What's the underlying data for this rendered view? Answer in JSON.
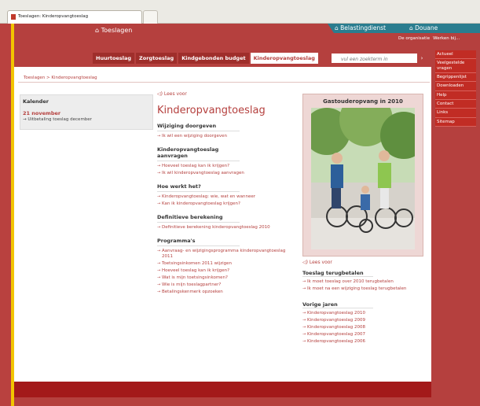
{
  "browser": {
    "tab_title": "Toeslagen: Kinderopvangtoeslag"
  },
  "header": {
    "home_label": "⌂ Toeslagen",
    "belastingdienst": "⌂ Belastingdienst",
    "douane": "⌂ Douane",
    "org_links": [
      "De organisatie",
      "Werken bij..."
    ]
  },
  "nav": {
    "tabs": [
      "Huurtoeslag",
      "Zorgtoeslag",
      "Kindgebonden budget",
      "Kinderopvangtoeslag"
    ],
    "active": "Kinderopvangtoeslag"
  },
  "search": {
    "placeholder": "vul een zoekterm in",
    "go": "›"
  },
  "right_menu": [
    "Actueel",
    "Veelgestelde vragen",
    "Begrippenlijst",
    "Downloaden",
    "Help",
    "Contact",
    "Links",
    "Sitemap"
  ],
  "breadcrumb": "Toeslagen > Kinderopvangtoeslag",
  "calendar": {
    "title": "Kalender",
    "date": "21 november",
    "event": "→ Uitbetaling toeslag december"
  },
  "main": {
    "lees_voor": "◁) Lees voor",
    "title": "Kinderopvangtoeslag",
    "sections": [
      {
        "heading": "Wijziging doorgeven",
        "links": [
          "Ik wil een wijziging doorgeven"
        ]
      },
      {
        "heading": "Kinderopvangtoeslag aanvragen",
        "links": [
          "Hoeveel toeslag kan ik krijgen?",
          "Ik wil kinderopvangtoeslag aanvragen"
        ]
      },
      {
        "heading": "Hoe werkt het?",
        "links": [
          "Kinderopvangtoeslag: wie, wat en wanneer",
          "Kan ik kinderopvangtoeslag krijgen?"
        ]
      },
      {
        "heading": "Definitieve berekening",
        "links": [
          "Definitieve berekening kinderopvangtoeslag 2010"
        ]
      },
      {
        "heading": "Programma's",
        "links": [
          "Aanvraag- en wijzigingsprogramma kinderopvangtoeslag 2011",
          "Toetsingsinkomen 2011 wijzigen",
          "Hoeveel toeslag kan ik krijgen?",
          "Wat is mijn toetsingsinkomen?",
          "Wie is mijn toeslagpartner?",
          "Betalingskenmerk opzoeken"
        ]
      }
    ]
  },
  "right": {
    "photo_caption": "Gastouderopvang in 2010",
    "lees_voor": "◁) Lees voor",
    "sections": [
      {
        "heading": "Toeslag terugbetalen",
        "links": [
          "Ik moet toeslag over 2010 terugbetalen",
          "Ik moet na een wijziging toeslag terugbetalen"
        ]
      },
      {
        "heading": "Vorige jaren",
        "links": [
          "Kinderopvangtoeslag 2010",
          "Kinderopvangtoeslag 2009",
          "Kinderopvangtoeslag 2008",
          "Kinderopvangtoeslag 2007",
          "Kinderopvangtoeslag 2006"
        ]
      }
    ]
  }
}
